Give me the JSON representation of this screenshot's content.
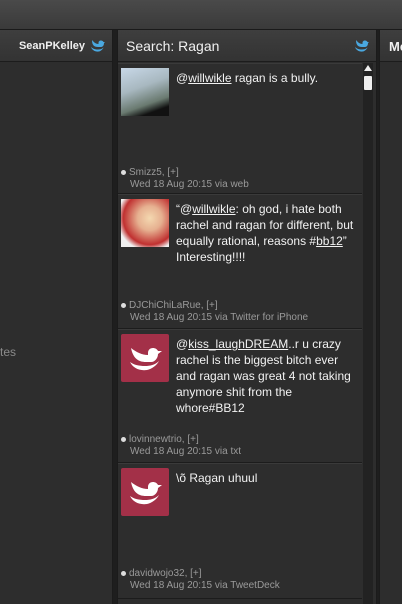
{
  "columns": {
    "left": {
      "title": "SeanPKelley",
      "side_text": "tes"
    },
    "main": {
      "title": "Search: Ragan"
    },
    "right": {
      "title": "Me"
    }
  },
  "tweets": [
    {
      "avatar": "photo",
      "text_pre": "@",
      "mention": "willwikle",
      "text_post": " ragan is a bully.",
      "user": "Smizz5, [+]",
      "time": "Wed 18 Aug 20:15 via web"
    },
    {
      "avatar": "photo",
      "text_pre": "“@",
      "mention": "willwikle",
      "text_post": ": oh god, i hate both rachel and ragan for different, but equally rational, reasons #",
      "hashtag": "bb12",
      "text_end": "” Interesting!!!!",
      "user": "DJChiChiLaRue, [+]",
      "time": "Wed 18 Aug 20:15 via Twitter for iPhone"
    },
    {
      "avatar": "default-bird",
      "text_pre": "@",
      "mention": "kiss_laughDREAM",
      "text_post": "..r u crazy rachel is the biggest bitch ever and ragan was great 4 not taking anymore shit from the whore#BB12",
      "user": "lovinnewtrio, [+]",
      "time": "Wed 18 Aug 20:15 via txt"
    },
    {
      "avatar": "default-bird",
      "text_pre": "\\õ Ragan uhuul",
      "user": "davidwojo32, [+]",
      "time": "Wed 18 Aug 20:15 via TweetDeck"
    }
  ],
  "colors": {
    "accent_bird": "#4aa8e0",
    "default_avatar": "#a33048"
  }
}
